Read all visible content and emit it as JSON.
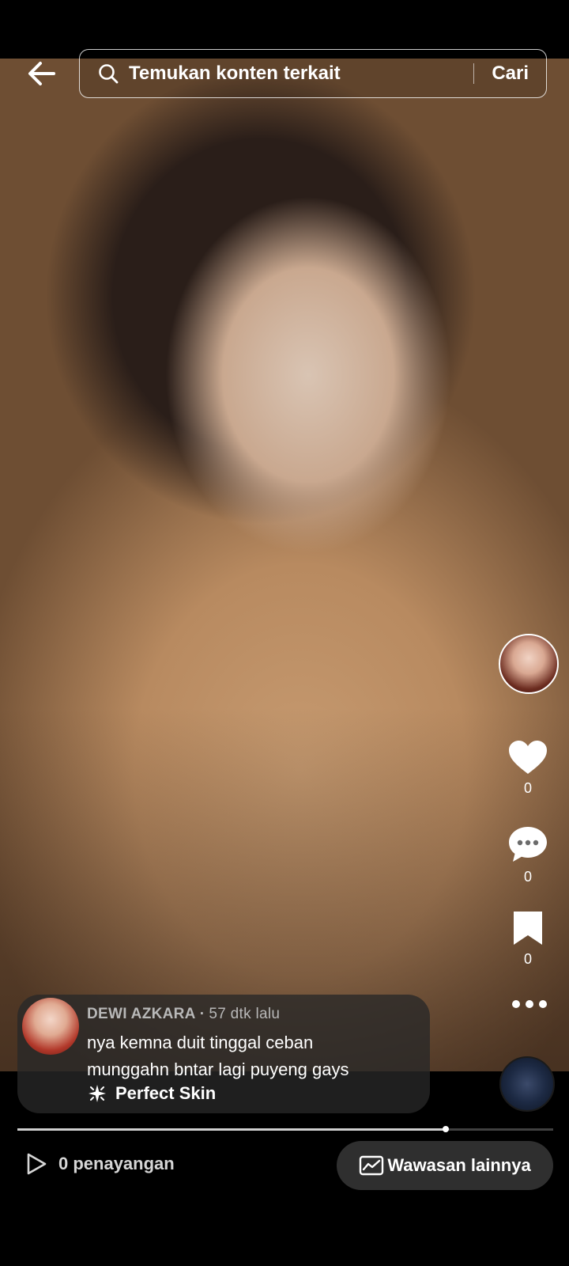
{
  "search": {
    "placeholder": "Temukan konten terkait",
    "submit_label": "Cari"
  },
  "post": {
    "author": "DEWI AZKARA",
    "separator": "·",
    "time_ago": "57 dtk lalu",
    "caption_line1": "nya kemna duit tinggal ceban",
    "caption_line2": "munggahn bntar lagi puyeng gays",
    "effect_name": "Perfect Skin"
  },
  "actions": {
    "likes": "0",
    "comments": "0",
    "saves": "0"
  },
  "playback": {
    "progress": 0.8
  },
  "footer": {
    "views_label": "0 penayangan",
    "insights_label": "Wawasan lainnya"
  },
  "icons": {
    "back": "arrow-left-icon",
    "search": "search-icon",
    "like": "heart-icon",
    "comment": "comment-bubble-icon",
    "save": "bookmark-icon",
    "more": "more-dots-icon",
    "effect": "sparkle-icon",
    "views": "play-outline-icon",
    "insights": "trend-chart-icon"
  },
  "colors": {
    "card_background": "#282828",
    "button_background": "#2f2f2f",
    "muted_text": "#b8b8b8"
  }
}
